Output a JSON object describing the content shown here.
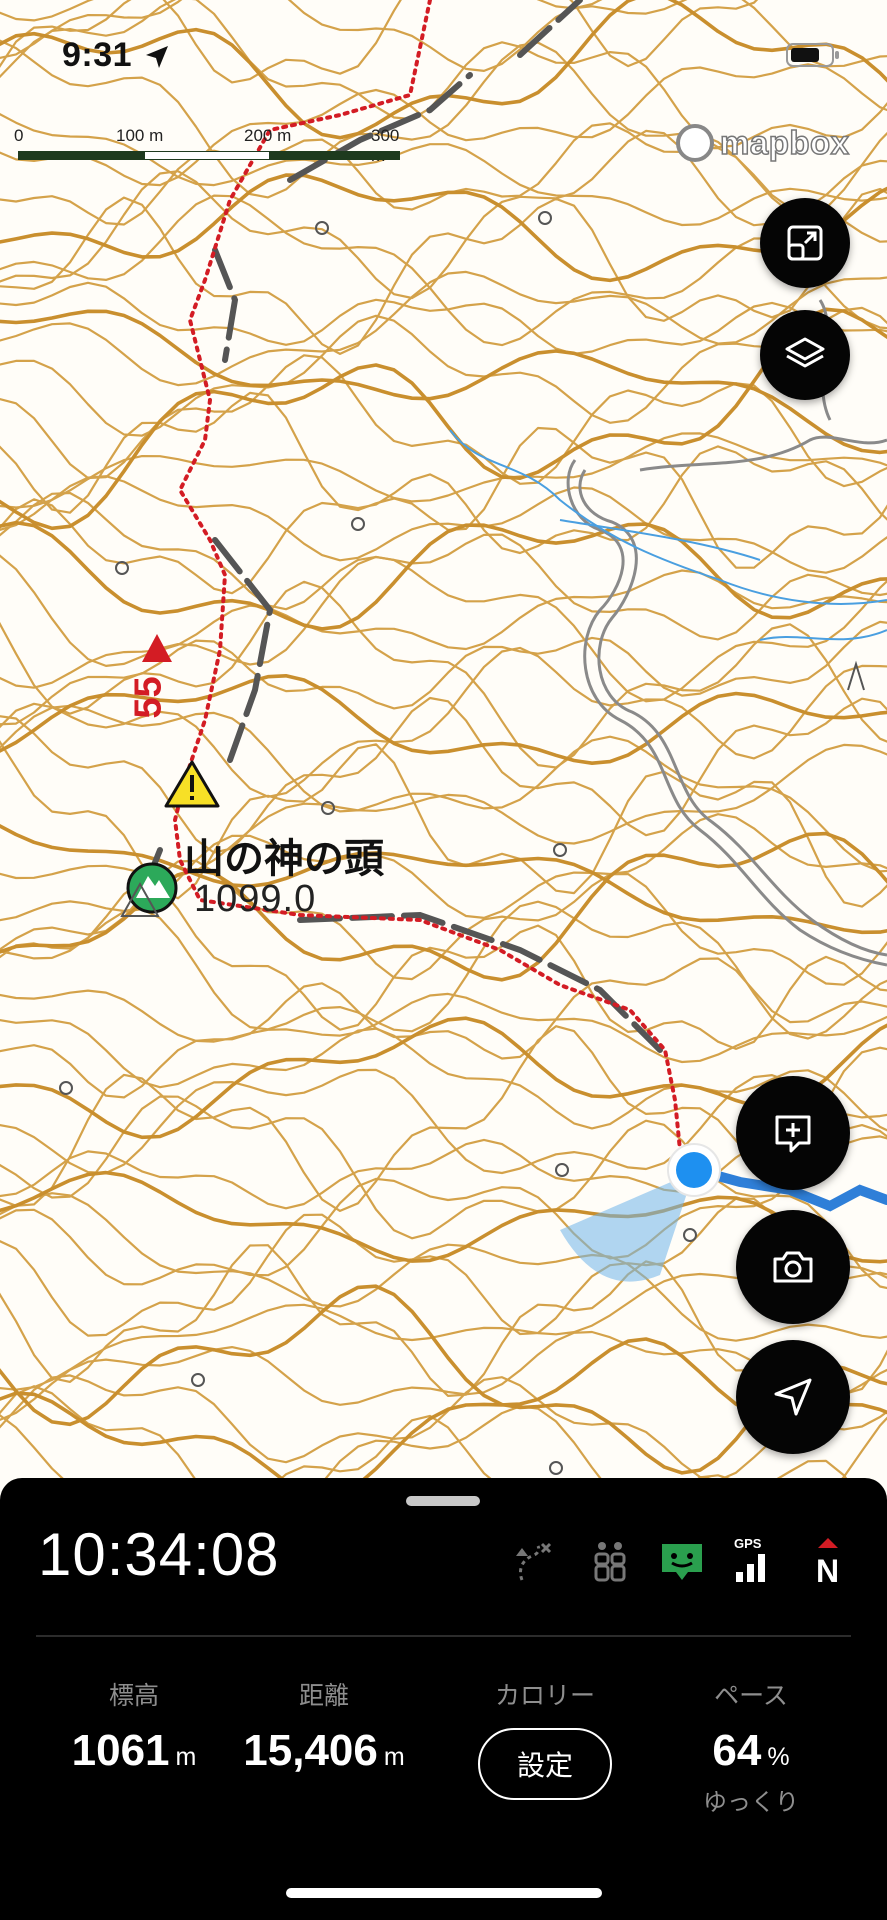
{
  "status_bar": {
    "time": "9:31"
  },
  "scale_bar": {
    "labels": [
      "0",
      "100 m",
      "200 m",
      "300 m"
    ]
  },
  "map": {
    "attribution": "mapbox",
    "peak_name": "山の神の頭",
    "peak_elevation": "1099.0",
    "route_number": "55",
    "colors": {
      "contour": "#d4a24a",
      "route": "#d31c24",
      "stream": "#4a9fe0",
      "road": "#8e8e8e",
      "location": "#1e90f0"
    }
  },
  "map_buttons": {
    "fit_bounds": "fit-bounds-icon",
    "layers": "layers-icon",
    "add_note": "add-note-icon",
    "camera": "camera-icon",
    "locate": "locate-icon"
  },
  "panel": {
    "clock": "10:34:08",
    "status_icons": [
      "route-off-icon",
      "people-icon",
      "chat-status-icon",
      "gps-signal-icon",
      "north-compass-icon"
    ],
    "gps_label": "GPS",
    "north_label": "N",
    "stats": {
      "elevation": {
        "title": "標高",
        "value": "1061",
        "unit": "m"
      },
      "distance": {
        "title": "距離",
        "value": "15,406",
        "unit": "m"
      },
      "calories": {
        "title": "カロリー",
        "button": "設定"
      },
      "pace": {
        "title": "ペース",
        "value": "64",
        "unit": "%",
        "note": "ゆっくり"
      }
    }
  }
}
